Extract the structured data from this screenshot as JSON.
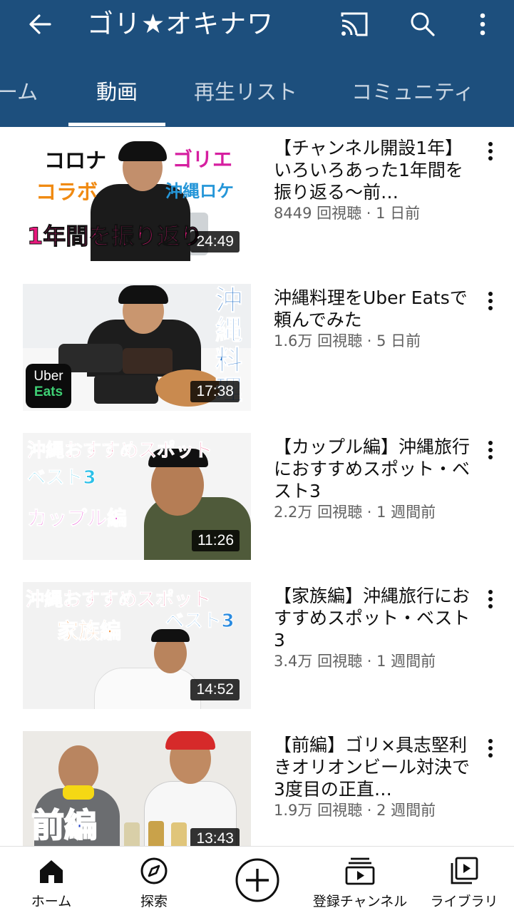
{
  "header": {
    "channel_title": "ゴリ★オキナワ",
    "tabs": [
      {
        "label": "ーム"
      },
      {
        "label": "動画"
      },
      {
        "label": "再生リスト"
      },
      {
        "label": "コミュニティ"
      }
    ],
    "active_tab": "動画",
    "colors": {
      "background": "#1d4f7d",
      "text": "#ffffff"
    }
  },
  "videos": [
    {
      "title": "【チャンネル開設1年】いろいろあった1年間を振り返る～前…",
      "meta": "8449 回視聴 · 1 日前",
      "duration": "24:49",
      "thumb_text": {
        "t1": "コロナ",
        "t2": "ゴリエ",
        "t3": "コラボ",
        "t4": "沖縄ロケ",
        "t5": "1年間を振り返り"
      }
    },
    {
      "title": "沖縄料理をUber Eatsで頼んでみた",
      "meta": "1.6万 回視聴 · 5 日前",
      "duration": "17:38",
      "thumb_text": {
        "t1": "沖縄料理",
        "logo1": "Uber",
        "logo2": "Eats"
      }
    },
    {
      "title": "【カップル編】沖縄旅行におすすめスポット・ベスト3",
      "meta": "2.2万 回視聴 · 1 週間前",
      "duration": "11:26",
      "thumb_text": {
        "t1": "沖縄おすすめスポット",
        "t2": "ベスト3",
        "t3": "カップル編"
      }
    },
    {
      "title": "【家族編】沖縄旅行におすすめスポット・ベスト3",
      "meta": "3.4万 回視聴 · 1 週間前",
      "duration": "14:52",
      "thumb_text": {
        "t1": "沖縄おすすめスポット",
        "t2": "家族編",
        "t3": "ベスト3"
      }
    },
    {
      "title": "【前編】ゴリ×具志堅利きオリオンビール対決で3度目の正直…",
      "meta": "1.9万 回視聴 · 2 週間前",
      "duration": "13:43",
      "thumb_text": {
        "t1": "前編"
      }
    }
  ],
  "bottom_nav": {
    "items": [
      {
        "label": "ホーム",
        "icon": "home-icon"
      },
      {
        "label": "探索",
        "icon": "explore-icon"
      },
      {
        "label": "",
        "icon": "create-icon"
      },
      {
        "label": "登録チャンネル",
        "icon": "subscriptions-icon"
      },
      {
        "label": "ライブラリ",
        "icon": "library-icon"
      }
    ]
  },
  "icons": {
    "back": "back-arrow-icon",
    "cast": "cast-icon",
    "search": "search-icon",
    "more": "more-vert-icon"
  }
}
